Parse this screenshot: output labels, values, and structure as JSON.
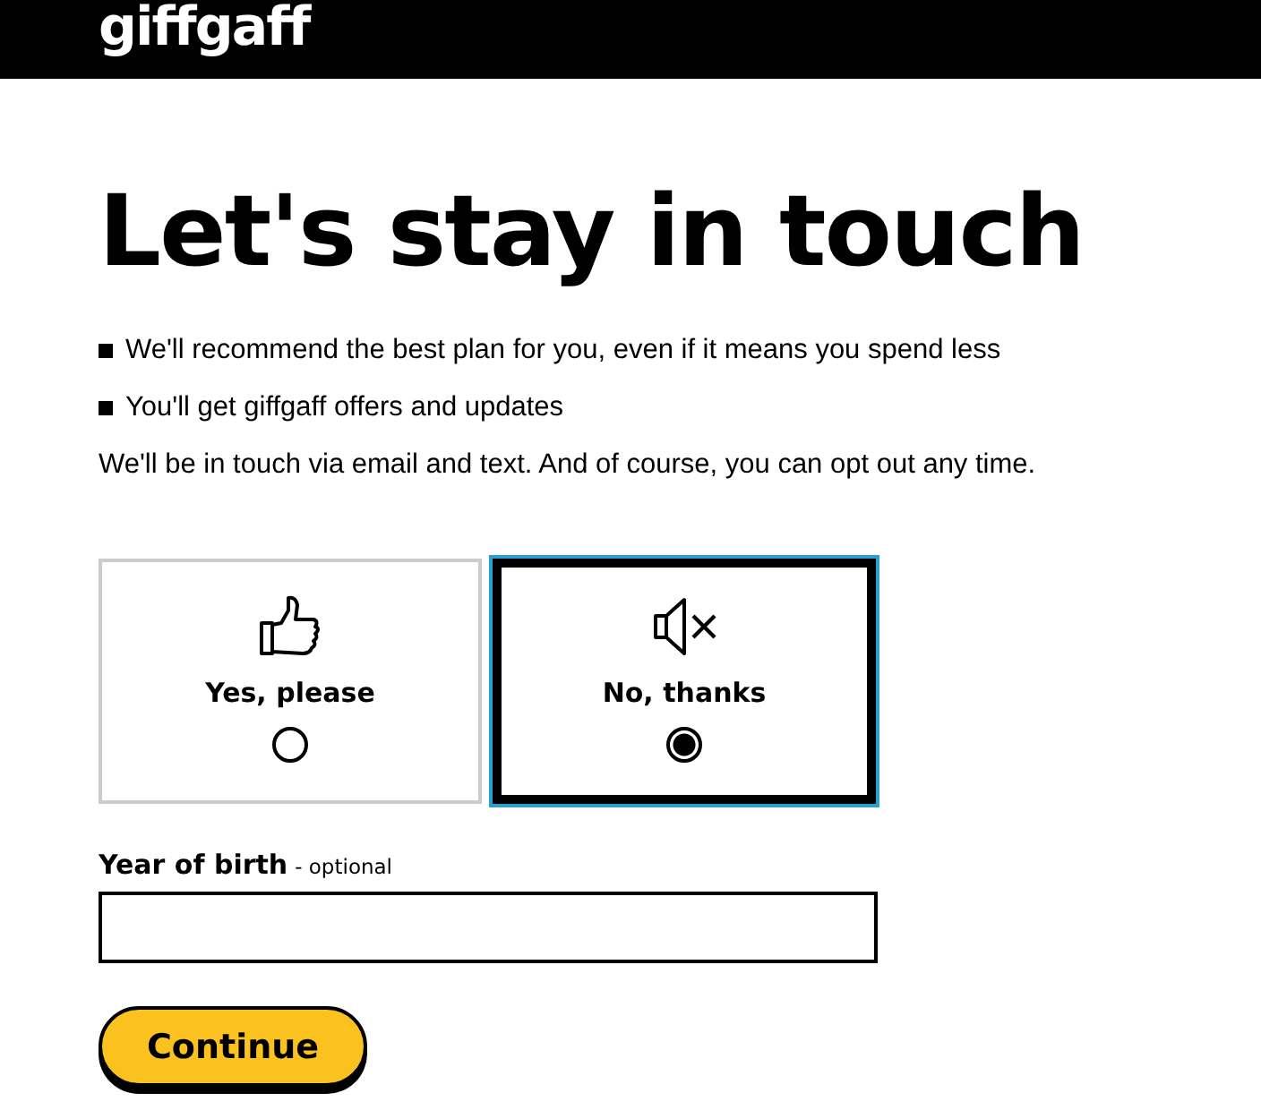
{
  "header": {
    "logo": "giffgaff"
  },
  "heading": "Let's stay in touch",
  "bullets": [
    "We'll recommend the best plan for you, even if it means you spend less",
    "You'll get giffgaff offers and updates"
  ],
  "note": "We'll be in touch via email and text. And of course, you can opt out any time.",
  "options": [
    {
      "kind": "thumbs-up",
      "label": "Yes, please",
      "selected": false
    },
    {
      "kind": "mute",
      "label": "No, thanks",
      "selected": true
    }
  ],
  "year_field": {
    "label": "Year of birth",
    "hint": "- optional"
  },
  "button": "Continue"
}
